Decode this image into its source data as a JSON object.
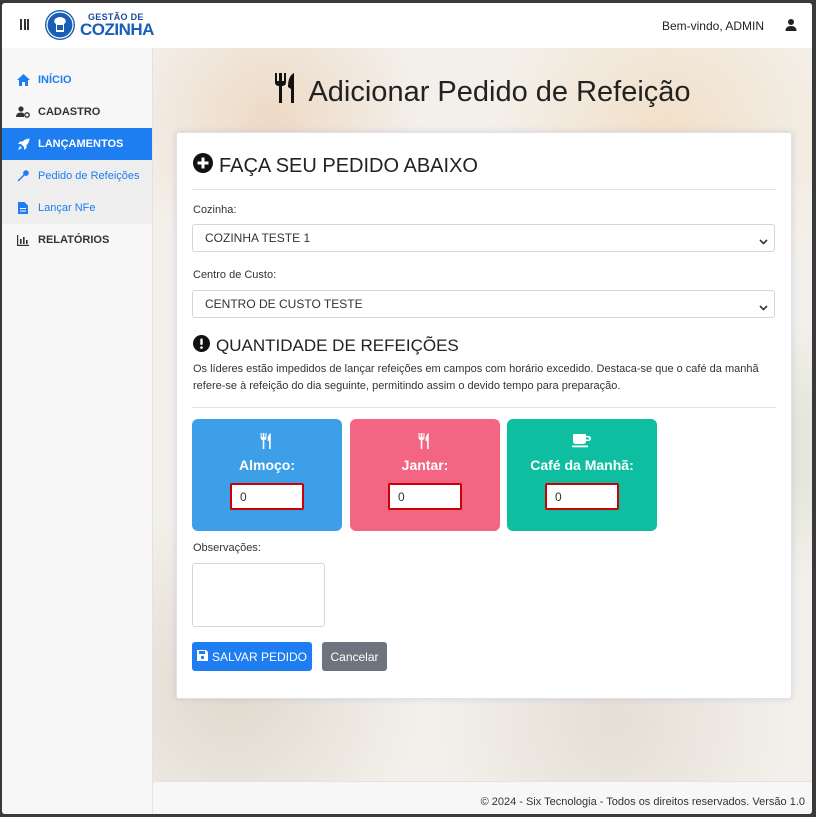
{
  "header": {
    "logo_line1": "GESTÃO DE",
    "logo_line2": "COZINHA",
    "welcome": "Bem-vindo, ADMIN"
  },
  "sidebar": {
    "items": [
      {
        "label": "INÍCIO",
        "icon": "home-icon"
      },
      {
        "label": "CADASTRO",
        "icon": "user-cog-icon"
      },
      {
        "label": "LANÇAMENTOS",
        "icon": "rocket-icon"
      },
      {
        "label": "Pedido de Refeições",
        "icon": "wrench-icon"
      },
      {
        "label": "Lançar NFe",
        "icon": "file-icon"
      },
      {
        "label": "RELATÓRIOS",
        "icon": "chart-icon"
      }
    ]
  },
  "page": {
    "title": "Adicionar Pedido de Refeição"
  },
  "form": {
    "heading": "FAÇA SEU PEDIDO ABAIXO",
    "kitchen_label": "Cozinha:",
    "kitchen_value": "COZINHA TESTE 1",
    "cost_center_label": "Centro de Custo:",
    "cost_center_value": "CENTRO DE CUSTO TESTE",
    "qty_heading": "QUANTIDADE DE REFEIÇÕES",
    "qty_description": "Os líderes estão impedidos de lançar refeições em campos com horário excedido. Destaca-se que o café da manhã refere-se à refeição do dia seguinte, permitindo assim o devido tempo para preparação.",
    "meals": [
      {
        "label": "Almoço:",
        "value": "0",
        "color": "#3d9fe8",
        "icon": "utensils-icon"
      },
      {
        "label": "Jantar:",
        "value": "0",
        "color": "#f46583",
        "icon": "utensils-icon"
      },
      {
        "label": "Café da Manhã:",
        "value": "0",
        "color": "#0dbfa0",
        "icon": "coffee-icon"
      }
    ],
    "observations_label": "Observações:",
    "save_label": "SALVAR PEDIDO",
    "cancel_label": "Cancelar"
  },
  "footer": {
    "text": "© 2024 - Six Tecnologia - Todos os direitos reservados. Versão 1.0"
  },
  "colors": {
    "primary": "#1e7df0",
    "secondary": "#6c757d",
    "invalid_border": "#cc0000"
  }
}
